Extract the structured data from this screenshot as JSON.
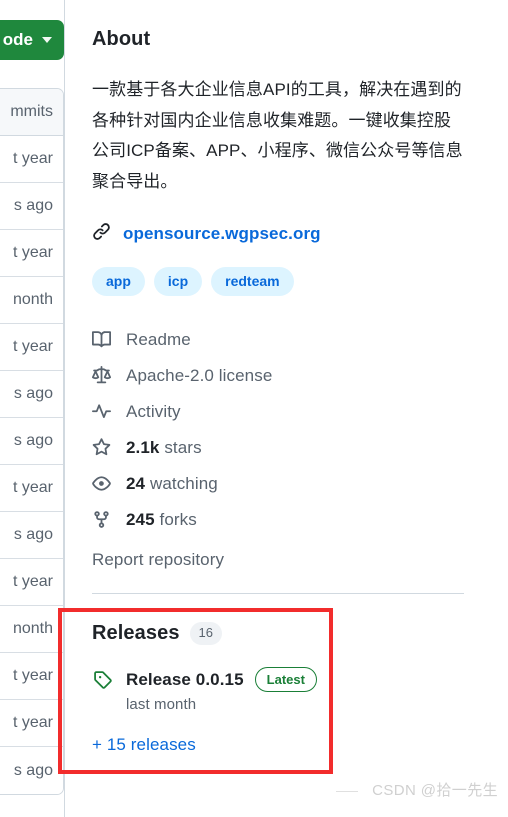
{
  "code_button": {
    "label": "ode",
    "caret_icon": "chevron-down-icon",
    "color": "#1f883d"
  },
  "file_table": {
    "rows": [
      {
        "text": "mmits",
        "is_header": true
      },
      {
        "text": "t year",
        "is_header": false
      },
      {
        "text": "s ago",
        "is_header": false
      },
      {
        "text": "t year",
        "is_header": false
      },
      {
        "text": "nonth",
        "is_header": false
      },
      {
        "text": "t year",
        "is_header": false
      },
      {
        "text": "s ago",
        "is_header": false
      },
      {
        "text": "s ago",
        "is_header": false
      },
      {
        "text": "t year",
        "is_header": false
      },
      {
        "text": "s ago",
        "is_header": false
      },
      {
        "text": "t year",
        "is_header": false
      },
      {
        "text": "nonth",
        "is_header": false
      },
      {
        "text": "t year",
        "is_header": false
      },
      {
        "text": "t year",
        "is_header": false
      },
      {
        "text": "s ago",
        "is_header": false
      }
    ]
  },
  "about": {
    "heading": "About",
    "description": "一款基于各大企业信息API的工具，解决在遇到的各种针对国内企业信息收集难题。一键收集控股公司ICP备案、APP、小程序、微信公众号等信息聚合导出。",
    "homepage": {
      "icon": "link-icon",
      "url_text": "opensource.wgpsec.org",
      "color": "#0969da"
    },
    "topics": [
      {
        "label": "app"
      },
      {
        "label": "icp"
      },
      {
        "label": "redteam"
      }
    ],
    "topic_bg": "#ddf4ff",
    "topic_fg": "#0969da"
  },
  "meta": [
    {
      "icon": "book-icon",
      "label": "Readme"
    },
    {
      "icon": "law-icon",
      "label": "Apache-2.0 license"
    },
    {
      "icon": "pulse-icon",
      "label": "Activity"
    },
    {
      "icon": "star-icon",
      "value": "2.1k",
      "label": "stars"
    },
    {
      "icon": "eye-icon",
      "value": "24",
      "label": "watching"
    },
    {
      "icon": "fork-icon",
      "value": "245",
      "label": "forks"
    }
  ],
  "report_repository": "Report repository",
  "releases": {
    "title": "Releases",
    "count": "16",
    "latest": {
      "tag_icon": "tag-icon",
      "name": "Release 0.0.15",
      "badge": "Latest",
      "badge_color": "#1a7f37",
      "date": "last month"
    },
    "more_link": "+ 15 releases"
  },
  "annotation": {
    "color": "#f22c2c"
  },
  "watermark": {
    "text": "CSDN @拾一先生"
  }
}
